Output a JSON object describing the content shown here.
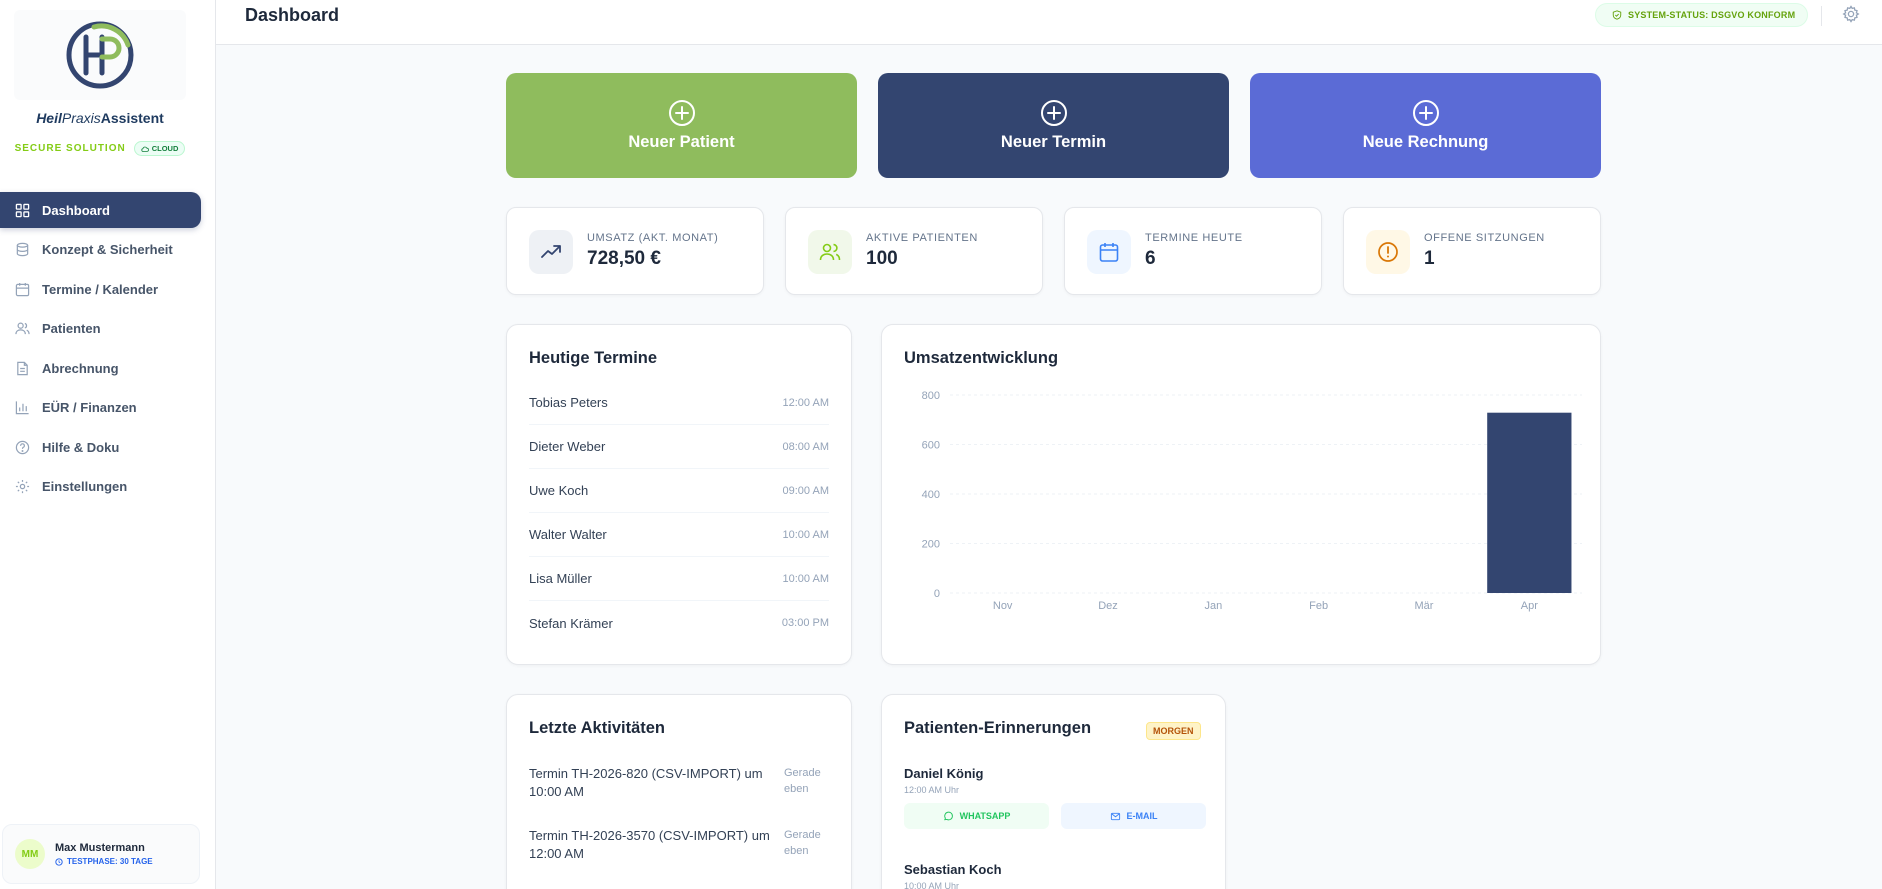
{
  "brand": {
    "part1": "Heil",
    "part2": "Praxis",
    "part3": "Assistent",
    "secure_label": "SECURE SOLUTION",
    "cloud_badge": "CLOUD",
    "logo_letters": "HP"
  },
  "nav": [
    {
      "label": "Dashboard",
      "icon": "dashboard-icon",
      "active": true
    },
    {
      "label": "Konzept & Sicherheit",
      "icon": "database-icon"
    },
    {
      "label": "Termine / Kalender",
      "icon": "calendar-icon"
    },
    {
      "label": "Patienten",
      "icon": "users-icon"
    },
    {
      "label": "Abrechnung",
      "icon": "document-icon"
    },
    {
      "label": "EÜR / Finanzen",
      "icon": "bar-chart-icon"
    },
    {
      "label": "Hilfe & Doku",
      "icon": "help-icon"
    },
    {
      "label": "Einstellungen",
      "icon": "gear-icon"
    }
  ],
  "user": {
    "initials": "MM",
    "name": "Max Mustermann",
    "trial": "TESTPHASE: 30 TAGE"
  },
  "header": {
    "title": "Dashboard",
    "status": "SYSTEM-STATUS: DSGVO KONFORM"
  },
  "actions": [
    {
      "label": "Neuer Patient",
      "color": "#8fbc5d"
    },
    {
      "label": "Neuer Termin",
      "color": "#334570"
    },
    {
      "label": "Neue Rechnung",
      "color": "#5b6bd6"
    }
  ],
  "stats": [
    {
      "label": "UMSATZ (AKT. MONAT)",
      "value": "728,50 €",
      "icon": "trending-up-icon"
    },
    {
      "label": "AKTIVE PATIENTEN",
      "value": "100",
      "icon": "users-icon"
    },
    {
      "label": "TERMINE HEUTE",
      "value": "6",
      "icon": "calendar-icon"
    },
    {
      "label": "OFFENE SITZUNGEN",
      "value": "1",
      "icon": "alert-circle-icon"
    }
  ],
  "today": {
    "title": "Heutige Termine",
    "items": [
      {
        "name": "Tobias Peters",
        "time": "12:00 AM"
      },
      {
        "name": "Dieter Weber",
        "time": "08:00 AM"
      },
      {
        "name": "Uwe Koch",
        "time": "09:00 AM"
      },
      {
        "name": "Walter Walter",
        "time": "10:00 AM"
      },
      {
        "name": "Lisa Müller",
        "time": "10:00 AM"
      },
      {
        "name": "Stefan Krämer",
        "time": "03:00 PM"
      }
    ]
  },
  "revenue": {
    "title": "Umsatzentwicklung"
  },
  "chart_data": {
    "type": "bar",
    "categories": [
      "Nov",
      "Dez",
      "Jan",
      "Feb",
      "Mär",
      "Apr"
    ],
    "values": [
      0,
      0,
      0,
      0,
      0,
      728.5
    ],
    "ylim": [
      0,
      800
    ],
    "yticks": [
      "0",
      "200",
      "400",
      "600",
      "800"
    ],
    "grid": true,
    "color": "#334570"
  },
  "activities": {
    "title": "Letzte Aktivitäten",
    "items": [
      {
        "text": "Termin TH-2026-820 (CSV-IMPORT) um 10:00 AM",
        "time": "Gerade eben"
      },
      {
        "text": "Termin TH-2026-3570 (CSV-IMPORT) um 12:00 AM",
        "time": "Gerade eben"
      }
    ]
  },
  "reminders": {
    "title": "Patienten-Erinnerungen",
    "badge": "MORGEN",
    "whatsapp_label": "WHATSAPP",
    "email_label": "E-MAIL",
    "items": [
      {
        "name": "Daniel König",
        "time": "12:00 AM Uhr"
      },
      {
        "name": "Sebastian Koch",
        "time": "10:00 AM Uhr"
      }
    ]
  }
}
